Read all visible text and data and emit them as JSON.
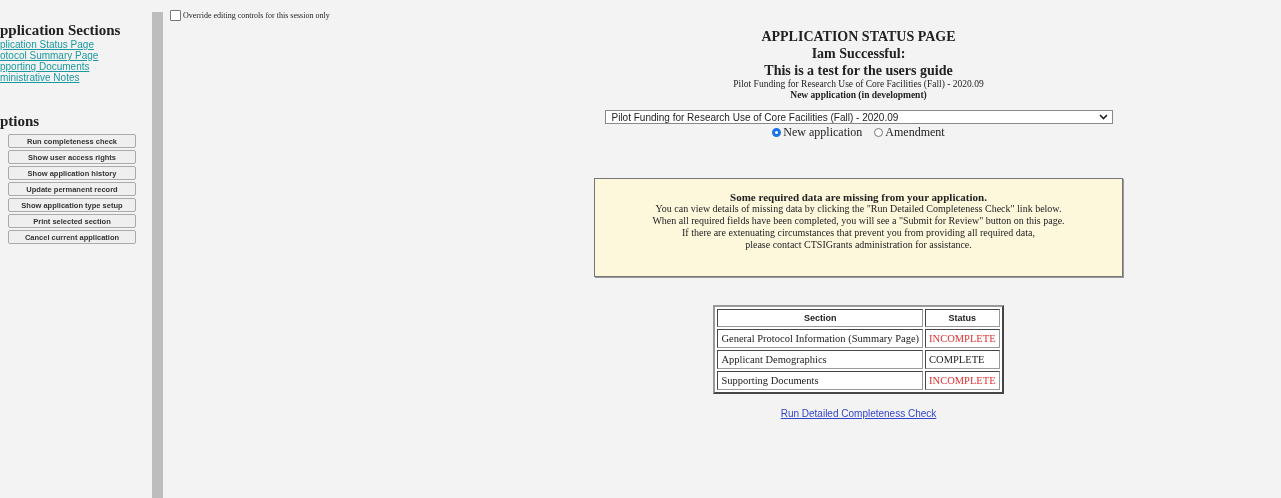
{
  "sidebar": {
    "sections_heading": "pplication Sections",
    "links": [
      "plication Status Page",
      "otocol Summary Page",
      "pporting Documents",
      "ministrative Notes"
    ],
    "options_heading": "ptions",
    "buttons": [
      "Run completeness check",
      "Show user access rights",
      "Show application history",
      "Update permanent record",
      "Show application type setup",
      "Print selected section",
      "Cancel current application"
    ]
  },
  "override": {
    "label": "Override editing controls for this session only",
    "checked": false
  },
  "header": {
    "title": "APPLICATION STATUS PAGE",
    "name": "Iam Successful:",
    "subtitle": "This is a test for the users guide",
    "program": "Pilot Funding for Research Use of Core Facilities (Fall) - 2020.09",
    "state": "New application (in development)"
  },
  "program_select": {
    "value": "Pilot Funding for Research Use of Core Facilities (Fall) - 2020.09"
  },
  "application_type": [
    {
      "label": "New application",
      "selected": true
    },
    {
      "label": "Amendment",
      "selected": false
    }
  ],
  "notice": {
    "heading": "Some required data are missing from your application.",
    "lines": [
      "You can view details of missing data by clicking the \"Run Detailed Completeness Check\" link below.",
      "When all required fields have been completed, you will see a \"Submit for Review\" button on this page.",
      "If there are extenuating circumstances that prevent you from providing all required data,",
      "please contact CTSIGrants administration for assistance."
    ]
  },
  "table": {
    "columns": [
      "Section",
      "Status"
    ],
    "rows": [
      {
        "section": "General Protocol Information (Summary Page)",
        "status": "INCOMPLETE",
        "complete": false
      },
      {
        "section": "Applicant Demographics",
        "status": "COMPLETE",
        "complete": true
      },
      {
        "section": "Supporting Documents",
        "status": "INCOMPLETE",
        "complete": false
      }
    ]
  },
  "completeness_link": "Run Detailed Completeness Check"
}
